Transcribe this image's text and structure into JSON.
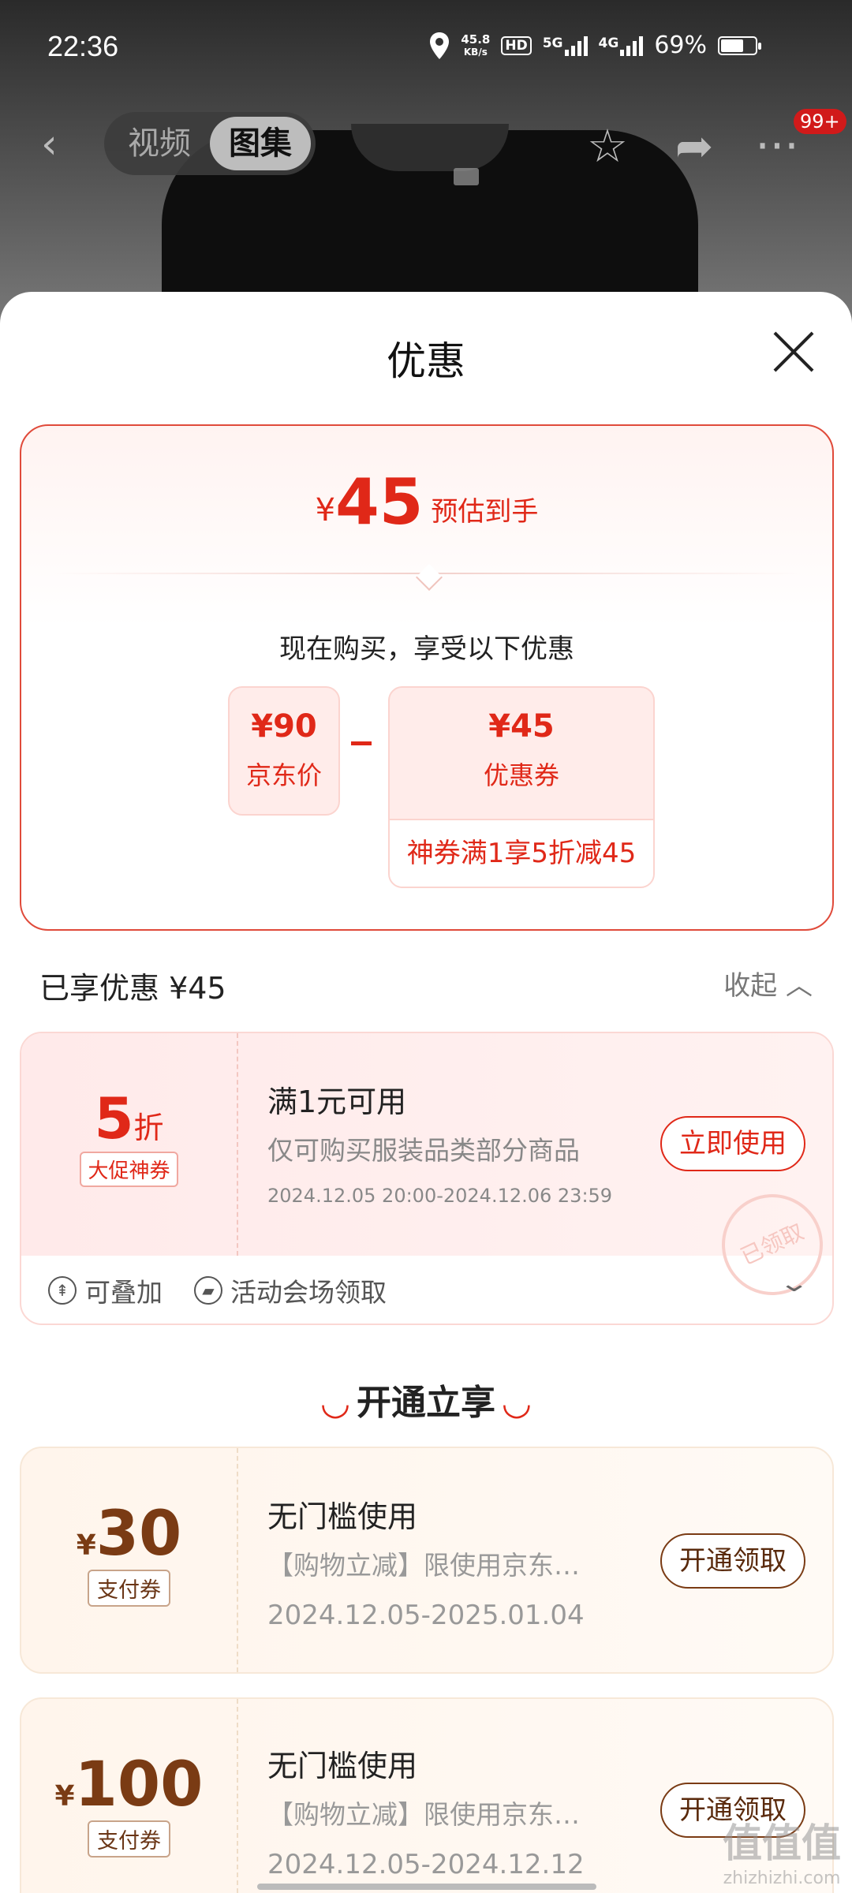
{
  "status_bar": {
    "time": "22:36",
    "net_speed_value": "45.8",
    "net_speed_unit": "KB/s",
    "hd_label": "HD",
    "sim1_label": "5G",
    "sim2_label": "4G",
    "battery_text": "69%"
  },
  "top_nav": {
    "tabs": [
      "视频",
      "图集"
    ],
    "active_tab": "图集",
    "badge": "99+"
  },
  "sheet": {
    "title": "优惠",
    "summary": {
      "currency": "¥",
      "estimated_price": "45",
      "estimated_label": "预估到手",
      "buy_now_text": "现在购买，享受以下优惠",
      "jd_price": "¥90",
      "jd_price_label": "京东价",
      "coupon_value": "¥45",
      "coupon_label": "优惠券",
      "coupon_detail": "神券满1享5折减45"
    },
    "enjoyed_text": "已享优惠 ¥45",
    "collapse_text": "收起",
    "coupon1": {
      "discount": "5",
      "discount_unit": "折",
      "tag": "大促神券",
      "title": "满1元可用",
      "desc": "仅可购买服装品类部分商品",
      "date": "2024.12.05 20:00-2024.12.06 23:59",
      "button": "立即使用",
      "stamp": "已领取",
      "footer_stackable": "可叠加",
      "footer_source": "活动会场领取"
    },
    "section_title": "开通立享",
    "pay_coupons": [
      {
        "currency": "¥",
        "amount": "30",
        "tag": "支付券",
        "title": "无门槛使用",
        "desc": "【购物立减】限使用京东…",
        "date": "2024.12.05-2025.01.04",
        "button": "开通领取"
      },
      {
        "currency": "¥",
        "amount": "100",
        "tag": "支付券",
        "title": "无门槛使用",
        "desc": "【购物立减】限使用京东…",
        "date": "2024.12.05-2024.12.12",
        "button": "开通领取"
      }
    ]
  },
  "watermark": {
    "logo": "值值值",
    "url": "zhizhizhi.com"
  }
}
